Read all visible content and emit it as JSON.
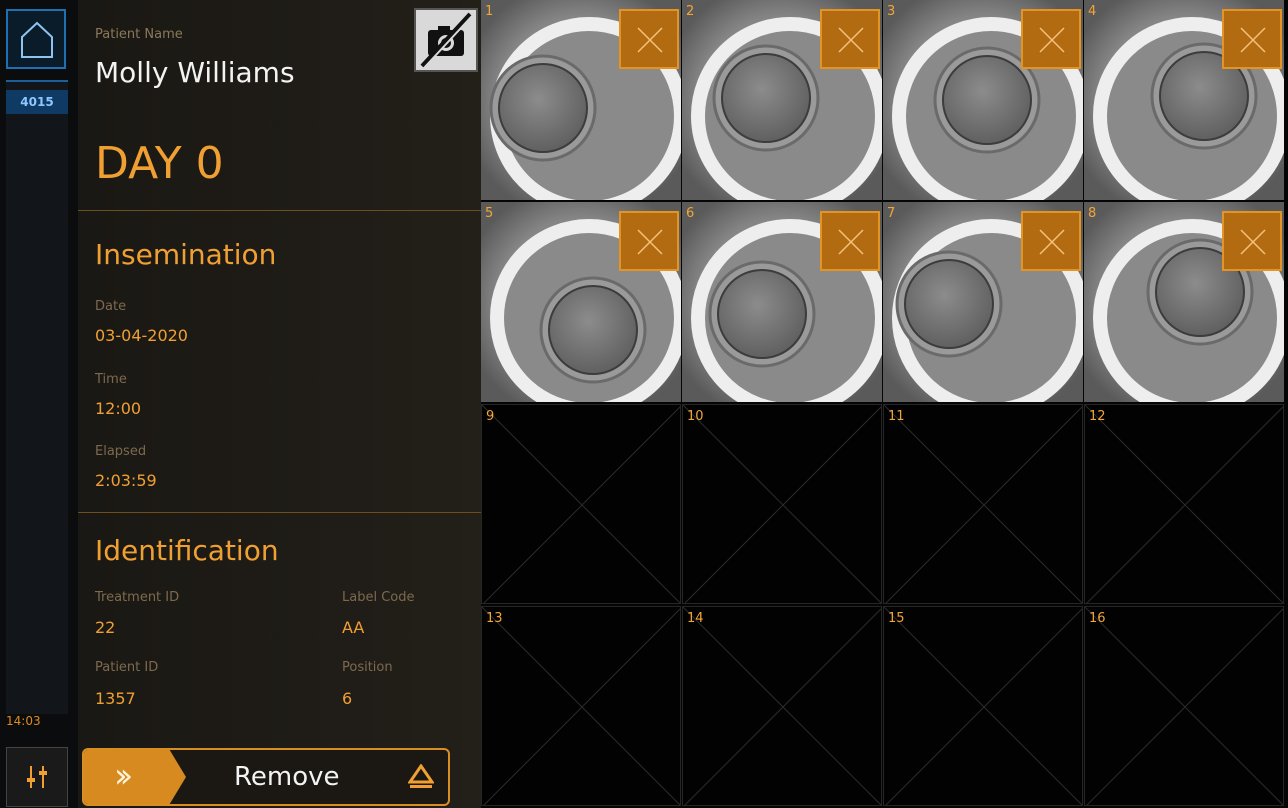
{
  "rail": {
    "slot_number": "4015",
    "clock": "14:03"
  },
  "patient": {
    "name_label": "Patient Name",
    "name": "Molly Williams",
    "day": "DAY 0"
  },
  "insemination": {
    "title": "Insemination",
    "date_label": "Date",
    "date": "03-04-2020",
    "time_label": "Time",
    "time": "12:00",
    "elapsed_label": "Elapsed",
    "elapsed": "2:03:59"
  },
  "identification": {
    "title": "Identification",
    "treatment_id_label": "Treatment ID",
    "treatment_id": "22",
    "label_code_label": "Label Code",
    "label_code": "AA",
    "patient_id_label": "Patient ID",
    "patient_id": "1357",
    "position_label": "Position",
    "position": "6"
  },
  "actions": {
    "remove_label": "Remove"
  },
  "wells": [
    {
      "number": "1",
      "has_embryo": true
    },
    {
      "number": "2",
      "has_embryo": true
    },
    {
      "number": "3",
      "has_embryo": true
    },
    {
      "number": "4",
      "has_embryo": true
    },
    {
      "number": "5",
      "has_embryo": true
    },
    {
      "number": "6",
      "has_embryo": true
    },
    {
      "number": "7",
      "has_embryo": true
    },
    {
      "number": "8",
      "has_embryo": true
    },
    {
      "number": "9",
      "has_embryo": false
    },
    {
      "number": "10",
      "has_embryo": false
    },
    {
      "number": "11",
      "has_embryo": false
    },
    {
      "number": "12",
      "has_embryo": false
    },
    {
      "number": "13",
      "has_embryo": false
    },
    {
      "number": "14",
      "has_embryo": false
    },
    {
      "number": "15",
      "has_embryo": false
    },
    {
      "number": "16",
      "has_embryo": false
    }
  ],
  "colors": {
    "accent": "#f0a033",
    "highlight_blue": "#1f6fb3"
  },
  "icons": {
    "home": "home-icon",
    "settings": "sliders-icon",
    "camera": "camera-off-icon",
    "deselect": "close-icon",
    "remove": "double-chevron-icon",
    "eject": "eject-icon"
  }
}
